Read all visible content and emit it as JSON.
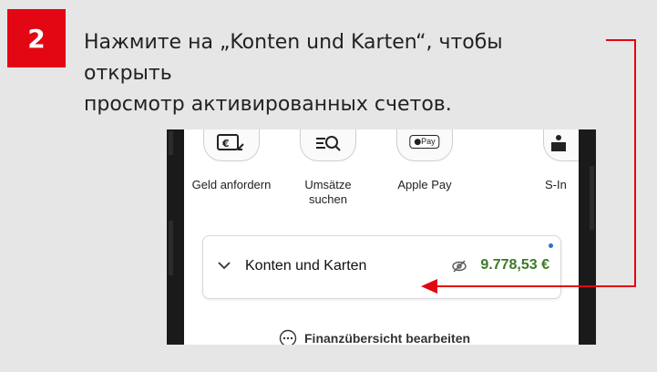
{
  "step": {
    "number": "2"
  },
  "instruction": {
    "line1": "Нажмите на „Konten und Karten“, чтобы открыть",
    "line2": "просмотр активированных счетов."
  },
  "quick_actions": [
    {
      "label": "Geld anfordern",
      "icon": "euro-request-icon"
    },
    {
      "label": "Umsätze suchen",
      "icon": "search-transactions-icon"
    },
    {
      "label": "Apple Pay",
      "icon": "apple-pay-icon",
      "icon_text": "Pay"
    },
    {
      "label": "S-In",
      "icon": "s-invest-icon"
    }
  ],
  "account_card": {
    "title": "Konten und Karten",
    "amount": "9.778,53 €",
    "amount_color": "#3b7a24"
  },
  "edit_overview": {
    "label": "Finanzübersicht bearbeiten"
  },
  "colors": {
    "accent": "#e30613",
    "panel_bg": "#e6e6e6",
    "indicator": "#2d6fd1"
  }
}
